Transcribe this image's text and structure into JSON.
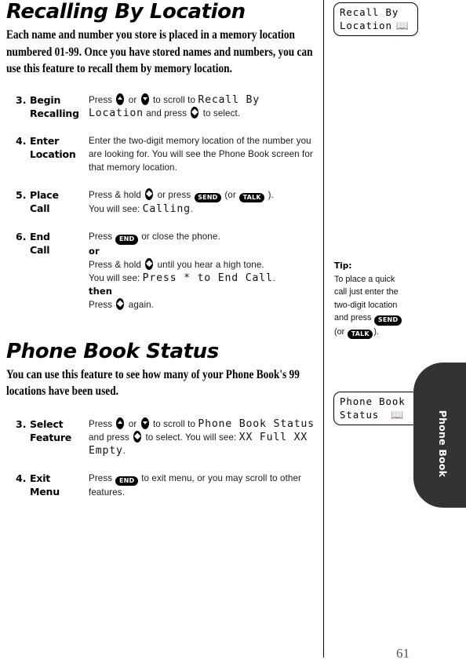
{
  "page": {
    "number": "61",
    "thumb_tab_label": "Phone Book"
  },
  "sections": [
    {
      "title": "Recalling By Location",
      "intro": "Each name and number you store is placed in a memory location numbered 01-99. Once you have stored names and numbers, you can use this feature to recall them by memory location.",
      "steps": [
        {
          "number": "3.",
          "label_line1": "Begin",
          "label_line2": "Recalling",
          "body_prefix": "Press",
          "body_mid": "or",
          "body_after_keys": "to scroll to",
          "lcd_1": "Recall By Location",
          "body_tail": "and press",
          "body_end": "to select."
        },
        {
          "number": "4.",
          "label_line1": "Enter",
          "label_line2": "Location",
          "body_text": "Enter the two-digit memory location of the number you are looking for. You will see the Phone Book screen for that memory location."
        },
        {
          "number": "5.",
          "label_line1": "Place",
          "label_line2": "Call",
          "body_prefix": "Press & hold",
          "body_mid": "or press",
          "btn_send": "SEND",
          "paren_open": "(or",
          "btn_talk": "TALK",
          "paren_close": ").",
          "body_line2_prefix": "You will see:",
          "lcd_1": "Calling",
          "body_line2_end": "."
        },
        {
          "number": "6.",
          "label_line1": "End",
          "label_line2": "Call",
          "body_prefix": "Press",
          "btn_end": "END",
          "body_after_btn": "or close the phone.",
          "word_or": "or",
          "line3_prefix": "Press & hold",
          "line3_end": "until you hear a high tone.",
          "line4_prefix": "You will see:",
          "lcd_1": "Press * to End Call",
          "line4_end": ".",
          "word_then": "then",
          "line5_prefix": "Press",
          "line5_end": "again."
        }
      ]
    },
    {
      "title": "Phone Book Status",
      "intro": "You can use this feature to see how many of your Phone Book's 99 locations have been used.",
      "steps": [
        {
          "number": "3.",
          "label_line1": "Select",
          "label_line2": "Feature",
          "body_prefix": "Press",
          "body_mid": "or",
          "body_after_keys": "to scroll to",
          "lcd_1": "Phone Book Status",
          "body_tail": "and press",
          "body_end": "to select. You will see:",
          "lcd_2": "XX Full XX Empty",
          "body_end2": "."
        },
        {
          "number": "4.",
          "label_line1": "Exit",
          "label_line2": "Menu",
          "body_prefix": "Press",
          "btn_end": "END",
          "body_after_btn": "to exit menu, or you may scroll to other features."
        }
      ]
    }
  ],
  "margin": {
    "lcd_screens": [
      {
        "line1": "Recall By",
        "line2": "Location",
        "icon": "book-icon"
      },
      {
        "line1": "Phone Book",
        "line2": "Status",
        "icon": "book-icon"
      }
    ],
    "tip": {
      "heading": "Tip:",
      "body_part1": "To place a quick call just enter the two-digit location and press",
      "btn_send": "SEND",
      "paren_open": "(or",
      "btn_talk": "TALK",
      "paren_close": ")."
    }
  },
  "icons": {
    "key_up": "up-arrow-key-icon",
    "key_down": "down-arrow-key-icon",
    "key_select": "select-diamond-key-icon",
    "book": "book-icon"
  },
  "colors": {
    "tab_background": "#333333",
    "page_number": "#58595b",
    "text": "#000000"
  }
}
